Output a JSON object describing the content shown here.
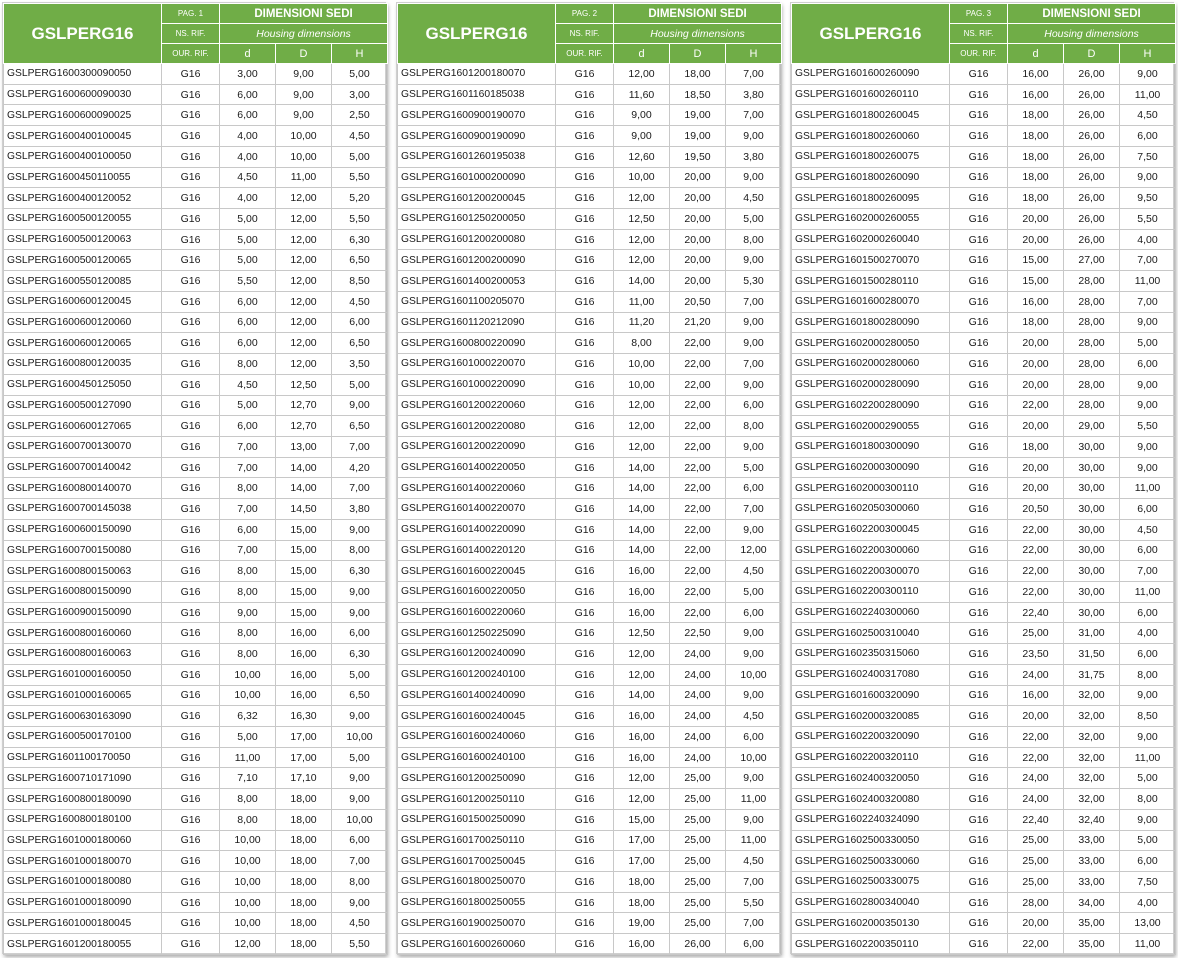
{
  "colors": {
    "header_green": "#70ad47",
    "header_text": "#ffffff",
    "grid": "#c8c8c8"
  },
  "pages": [
    {
      "title": "GSLPERG16",
      "page_label": "PAG. 1",
      "ns_rif": "NS. RIF.",
      "our_rif": "OUR. RIF.",
      "dim_title": "DIMENSIONI SEDI",
      "dim_subtitle": "Housing dimensions",
      "col_d": "d",
      "col_D": "D",
      "col_H": "H",
      "rows": [
        [
          "GSLPERG1600300090050",
          "G16",
          "3,00",
          "9,00",
          "5,00"
        ],
        [
          "GSLPERG1600600090030",
          "G16",
          "6,00",
          "9,00",
          "3,00"
        ],
        [
          "GSLPERG1600600090025",
          "G16",
          "6,00",
          "9,00",
          "2,50"
        ],
        [
          "GSLPERG1600400100045",
          "G16",
          "4,00",
          "10,00",
          "4,50"
        ],
        [
          "GSLPERG1600400100050",
          "G16",
          "4,00",
          "10,00",
          "5,00"
        ],
        [
          "GSLPERG1600450110055",
          "G16",
          "4,50",
          "11,00",
          "5,50"
        ],
        [
          "GSLPERG1600400120052",
          "G16",
          "4,00",
          "12,00",
          "5,20"
        ],
        [
          "GSLPERG1600500120055",
          "G16",
          "5,00",
          "12,00",
          "5,50"
        ],
        [
          "GSLPERG1600500120063",
          "G16",
          "5,00",
          "12,00",
          "6,30"
        ],
        [
          "GSLPERG1600500120065",
          "G16",
          "5,00",
          "12,00",
          "6,50"
        ],
        [
          "GSLPERG1600550120085",
          "G16",
          "5,50",
          "12,00",
          "8,50"
        ],
        [
          "GSLPERG1600600120045",
          "G16",
          "6,00",
          "12,00",
          "4,50"
        ],
        [
          "GSLPERG1600600120060",
          "G16",
          "6,00",
          "12,00",
          "6,00"
        ],
        [
          "GSLPERG1600600120065",
          "G16",
          "6,00",
          "12,00",
          "6,50"
        ],
        [
          "GSLPERG1600800120035",
          "G16",
          "8,00",
          "12,00",
          "3,50"
        ],
        [
          "GSLPERG1600450125050",
          "G16",
          "4,50",
          "12,50",
          "5,00"
        ],
        [
          "GSLPERG1600500127090",
          "G16",
          "5,00",
          "12,70",
          "9,00"
        ],
        [
          "GSLPERG1600600127065",
          "G16",
          "6,00",
          "12,70",
          "6,50"
        ],
        [
          "GSLPERG1600700130070",
          "G16",
          "7,00",
          "13,00",
          "7,00"
        ],
        [
          "GSLPERG1600700140042",
          "G16",
          "7,00",
          "14,00",
          "4,20"
        ],
        [
          "GSLPERG1600800140070",
          "G16",
          "8,00",
          "14,00",
          "7,00"
        ],
        [
          "GSLPERG1600700145038",
          "G16",
          "7,00",
          "14,50",
          "3,80"
        ],
        [
          "GSLPERG1600600150090",
          "G16",
          "6,00",
          "15,00",
          "9,00"
        ],
        [
          "GSLPERG1600700150080",
          "G16",
          "7,00",
          "15,00",
          "8,00"
        ],
        [
          "GSLPERG1600800150063",
          "G16",
          "8,00",
          "15,00",
          "6,30"
        ],
        [
          "GSLPERG1600800150090",
          "G16",
          "8,00",
          "15,00",
          "9,00"
        ],
        [
          "GSLPERG1600900150090",
          "G16",
          "9,00",
          "15,00",
          "9,00"
        ],
        [
          "GSLPERG1600800160060",
          "G16",
          "8,00",
          "16,00",
          "6,00"
        ],
        [
          "GSLPERG1600800160063",
          "G16",
          "8,00",
          "16,00",
          "6,30"
        ],
        [
          "GSLPERG1601000160050",
          "G16",
          "10,00",
          "16,00",
          "5,00"
        ],
        [
          "GSLPERG1601000160065",
          "G16",
          "10,00",
          "16,00",
          "6,50"
        ],
        [
          "GSLPERG1600630163090",
          "G16",
          "6,32",
          "16,30",
          "9,00"
        ],
        [
          "GSLPERG1600500170100",
          "G16",
          "5,00",
          "17,00",
          "10,00"
        ],
        [
          "GSLPERG1601100170050",
          "G16",
          "11,00",
          "17,00",
          "5,00"
        ],
        [
          "GSLPERG1600710171090",
          "G16",
          "7,10",
          "17,10",
          "9,00"
        ],
        [
          "GSLPERG1600800180090",
          "G16",
          "8,00",
          "18,00",
          "9,00"
        ],
        [
          "GSLPERG1600800180100",
          "G16",
          "8,00",
          "18,00",
          "10,00"
        ],
        [
          "GSLPERG1601000180060",
          "G16",
          "10,00",
          "18,00",
          "6,00"
        ],
        [
          "GSLPERG1601000180070",
          "G16",
          "10,00",
          "18,00",
          "7,00"
        ],
        [
          "GSLPERG1601000180080",
          "G16",
          "10,00",
          "18,00",
          "8,00"
        ],
        [
          "GSLPERG1601000180090",
          "G16",
          "10,00",
          "18,00",
          "9,00"
        ],
        [
          "GSLPERG1601000180045",
          "G16",
          "10,00",
          "18,00",
          "4,50"
        ],
        [
          "GSLPERG1601200180055",
          "G16",
          "12,00",
          "18,00",
          "5,50"
        ]
      ]
    },
    {
      "title": "GSLPERG16",
      "page_label": "PAG. 2",
      "ns_rif": "NS. RIF.",
      "our_rif": "OUR. RIF.",
      "dim_title": "DIMENSIONI SEDI",
      "dim_subtitle": "Housing dimensions",
      "col_d": "d",
      "col_D": "D",
      "col_H": "H",
      "rows": [
        [
          "GSLPERG1601200180070",
          "G16",
          "12,00",
          "18,00",
          "7,00"
        ],
        [
          "GSLPERG1601160185038",
          "G16",
          "11,60",
          "18,50",
          "3,80"
        ],
        [
          "GSLPERG1600900190070",
          "G16",
          "9,00",
          "19,00",
          "7,00"
        ],
        [
          "GSLPERG1600900190090",
          "G16",
          "9,00",
          "19,00",
          "9,00"
        ],
        [
          "GSLPERG1601260195038",
          "G16",
          "12,60",
          "19,50",
          "3,80"
        ],
        [
          "GSLPERG1601000200090",
          "G16",
          "10,00",
          "20,00",
          "9,00"
        ],
        [
          "GSLPERG1601200200045",
          "G16",
          "12,00",
          "20,00",
          "4,50"
        ],
        [
          "GSLPERG1601250200050",
          "G16",
          "12,50",
          "20,00",
          "5,00"
        ],
        [
          "GSLPERG1601200200080",
          "G16",
          "12,00",
          "20,00",
          "8,00"
        ],
        [
          "GSLPERG1601200200090",
          "G16",
          "12,00",
          "20,00",
          "9,00"
        ],
        [
          "GSLPERG1601400200053",
          "G16",
          "14,00",
          "20,00",
          "5,30"
        ],
        [
          "GSLPERG1601100205070",
          "G16",
          "11,00",
          "20,50",
          "7,00"
        ],
        [
          "GSLPERG1601120212090",
          "G16",
          "11,20",
          "21,20",
          "9,00"
        ],
        [
          "GSLPERG1600800220090",
          "G16",
          "8,00",
          "22,00",
          "9,00"
        ],
        [
          "GSLPERG1601000220070",
          "G16",
          "10,00",
          "22,00",
          "7,00"
        ],
        [
          "GSLPERG1601000220090",
          "G16",
          "10,00",
          "22,00",
          "9,00"
        ],
        [
          "GSLPERG1601200220060",
          "G16",
          "12,00",
          "22,00",
          "6,00"
        ],
        [
          "GSLPERG1601200220080",
          "G16",
          "12,00",
          "22,00",
          "8,00"
        ],
        [
          "GSLPERG1601200220090",
          "G16",
          "12,00",
          "22,00",
          "9,00"
        ],
        [
          "GSLPERG1601400220050",
          "G16",
          "14,00",
          "22,00",
          "5,00"
        ],
        [
          "GSLPERG1601400220060",
          "G16",
          "14,00",
          "22,00",
          "6,00"
        ],
        [
          "GSLPERG1601400220070",
          "G16",
          "14,00",
          "22,00",
          "7,00"
        ],
        [
          "GSLPERG1601400220090",
          "G16",
          "14,00",
          "22,00",
          "9,00"
        ],
        [
          "GSLPERG1601400220120",
          "G16",
          "14,00",
          "22,00",
          "12,00"
        ],
        [
          "GSLPERG1601600220045",
          "G16",
          "16,00",
          "22,00",
          "4,50"
        ],
        [
          "GSLPERG1601600220050",
          "G16",
          "16,00",
          "22,00",
          "5,00"
        ],
        [
          "GSLPERG1601600220060",
          "G16",
          "16,00",
          "22,00",
          "6,00"
        ],
        [
          "GSLPERG1601250225090",
          "G16",
          "12,50",
          "22,50",
          "9,00"
        ],
        [
          "GSLPERG1601200240090",
          "G16",
          "12,00",
          "24,00",
          "9,00"
        ],
        [
          "GSLPERG1601200240100",
          "G16",
          "12,00",
          "24,00",
          "10,00"
        ],
        [
          "GSLPERG1601400240090",
          "G16",
          "14,00",
          "24,00",
          "9,00"
        ],
        [
          "GSLPERG1601600240045",
          "G16",
          "16,00",
          "24,00",
          "4,50"
        ],
        [
          "GSLPERG1601600240060",
          "G16",
          "16,00",
          "24,00",
          "6,00"
        ],
        [
          "GSLPERG1601600240100",
          "G16",
          "16,00",
          "24,00",
          "10,00"
        ],
        [
          "GSLPERG1601200250090",
          "G16",
          "12,00",
          "25,00",
          "9,00"
        ],
        [
          "GSLPERG1601200250110",
          "G16",
          "12,00",
          "25,00",
          "11,00"
        ],
        [
          "GSLPERG1601500250090",
          "G16",
          "15,00",
          "25,00",
          "9,00"
        ],
        [
          "GSLPERG1601700250110",
          "G16",
          "17,00",
          "25,00",
          "11,00"
        ],
        [
          "GSLPERG1601700250045",
          "G16",
          "17,00",
          "25,00",
          "4,50"
        ],
        [
          "GSLPERG1601800250070",
          "G16",
          "18,00",
          "25,00",
          "7,00"
        ],
        [
          "GSLPERG1601800250055",
          "G16",
          "18,00",
          "25,00",
          "5,50"
        ],
        [
          "GSLPERG1601900250070",
          "G16",
          "19,00",
          "25,00",
          "7,00"
        ],
        [
          "GSLPERG1601600260060",
          "G16",
          "16,00",
          "26,00",
          "6,00"
        ]
      ]
    },
    {
      "title": "GSLPERG16",
      "page_label": "PAG. 3",
      "ns_rif": "NS. RIF.",
      "our_rif": "OUR. RIF.",
      "dim_title": "DIMENSIONI SEDI",
      "dim_subtitle": "Housing dimensions",
      "col_d": "d",
      "col_D": "D",
      "col_H": "H",
      "rows": [
        [
          "GSLPERG1601600260090",
          "G16",
          "16,00",
          "26,00",
          "9,00"
        ],
        [
          "GSLPERG1601600260110",
          "G16",
          "16,00",
          "26,00",
          "11,00"
        ],
        [
          "GSLPERG1601800260045",
          "G16",
          "18,00",
          "26,00",
          "4,50"
        ],
        [
          "GSLPERG1601800260060",
          "G16",
          "18,00",
          "26,00",
          "6,00"
        ],
        [
          "GSLPERG1601800260075",
          "G16",
          "18,00",
          "26,00",
          "7,50"
        ],
        [
          "GSLPERG1601800260090",
          "G16",
          "18,00",
          "26,00",
          "9,00"
        ],
        [
          "GSLPERG1601800260095",
          "G16",
          "18,00",
          "26,00",
          "9,50"
        ],
        [
          "GSLPERG1602000260055",
          "G16",
          "20,00",
          "26,00",
          "5,50"
        ],
        [
          "GSLPERG1602000260040",
          "G16",
          "20,00",
          "26,00",
          "4,00"
        ],
        [
          "GSLPERG1601500270070",
          "G16",
          "15,00",
          "27,00",
          "7,00"
        ],
        [
          "GSLPERG1601500280110",
          "G16",
          "15,00",
          "28,00",
          "11,00"
        ],
        [
          "GSLPERG1601600280070",
          "G16",
          "16,00",
          "28,00",
          "7,00"
        ],
        [
          "GSLPERG1601800280090",
          "G16",
          "18,00",
          "28,00",
          "9,00"
        ],
        [
          "GSLPERG1602000280050",
          "G16",
          "20,00",
          "28,00",
          "5,00"
        ],
        [
          "GSLPERG1602000280060",
          "G16",
          "20,00",
          "28,00",
          "6,00"
        ],
        [
          "GSLPERG1602000280090",
          "G16",
          "20,00",
          "28,00",
          "9,00"
        ],
        [
          "GSLPERG1602200280090",
          "G16",
          "22,00",
          "28,00",
          "9,00"
        ],
        [
          "GSLPERG1602000290055",
          "G16",
          "20,00",
          "29,00",
          "5,50"
        ],
        [
          "GSLPERG1601800300090",
          "G16",
          "18,00",
          "30,00",
          "9,00"
        ],
        [
          "GSLPERG1602000300090",
          "G16",
          "20,00",
          "30,00",
          "9,00"
        ],
        [
          "GSLPERG1602000300110",
          "G16",
          "20,00",
          "30,00",
          "11,00"
        ],
        [
          "GSLPERG1602050300060",
          "G16",
          "20,50",
          "30,00",
          "6,00"
        ],
        [
          "GSLPERG1602200300045",
          "G16",
          "22,00",
          "30,00",
          "4,50"
        ],
        [
          "GSLPERG1602200300060",
          "G16",
          "22,00",
          "30,00",
          "6,00"
        ],
        [
          "GSLPERG1602200300070",
          "G16",
          "22,00",
          "30,00",
          "7,00"
        ],
        [
          "GSLPERG1602200300110",
          "G16",
          "22,00",
          "30,00",
          "11,00"
        ],
        [
          "GSLPERG1602240300060",
          "G16",
          "22,40",
          "30,00",
          "6,00"
        ],
        [
          "GSLPERG1602500310040",
          "G16",
          "25,00",
          "31,00",
          "4,00"
        ],
        [
          "GSLPERG1602350315060",
          "G16",
          "23,50",
          "31,50",
          "6,00"
        ],
        [
          "GSLPERG1602400317080",
          "G16",
          "24,00",
          "31,75",
          "8,00"
        ],
        [
          "GSLPERG1601600320090",
          "G16",
          "16,00",
          "32,00",
          "9,00"
        ],
        [
          "GSLPERG1602000320085",
          "G16",
          "20,00",
          "32,00",
          "8,50"
        ],
        [
          "GSLPERG1602200320090",
          "G16",
          "22,00",
          "32,00",
          "9,00"
        ],
        [
          "GSLPERG1602200320110",
          "G16",
          "22,00",
          "32,00",
          "11,00"
        ],
        [
          "GSLPERG1602400320050",
          "G16",
          "24,00",
          "32,00",
          "5,00"
        ],
        [
          "GSLPERG1602400320080",
          "G16",
          "24,00",
          "32,00",
          "8,00"
        ],
        [
          "GSLPERG1602240324090",
          "G16",
          "22,40",
          "32,40",
          "9,00"
        ],
        [
          "GSLPERG1602500330050",
          "G16",
          "25,00",
          "33,00",
          "5,00"
        ],
        [
          "GSLPERG1602500330060",
          "G16",
          "25,00",
          "33,00",
          "6,00"
        ],
        [
          "GSLPERG1602500330075",
          "G16",
          "25,00",
          "33,00",
          "7,50"
        ],
        [
          "GSLPERG1602800340040",
          "G16",
          "28,00",
          "34,00",
          "4,00"
        ],
        [
          "GSLPERG1602000350130",
          "G16",
          "20,00",
          "35,00",
          "13,00"
        ],
        [
          "GSLPERG1602200350110",
          "G16",
          "22,00",
          "35,00",
          "11,00"
        ]
      ]
    }
  ]
}
